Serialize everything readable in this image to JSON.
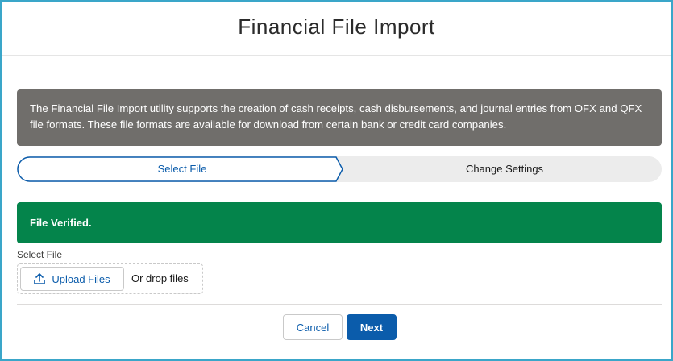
{
  "modal": {
    "title": "Financial File Import"
  },
  "info_banner": {
    "text": "The Financial File Import utility supports the creation of cash receipts, cash disbursements, and journal entries from OFX and QFX file formats. These file formats are available for download from certain bank or credit card companies."
  },
  "path": {
    "steps": [
      {
        "label": "Select File",
        "state": "current"
      },
      {
        "label": "Change Settings",
        "state": "incomplete"
      }
    ]
  },
  "success_banner": {
    "text": "File Verified."
  },
  "file_upload": {
    "label": "Select File",
    "button_label": "Upload Files",
    "button_icon": "upload-icon",
    "drop_text": "Or drop files"
  },
  "footer": {
    "cancel_label": "Cancel",
    "next_label": "Next"
  },
  "colors": {
    "frame_border": "#3aa6c9",
    "info_banner_bg": "#706e6b",
    "success_banner_bg": "#04844b",
    "brand_blue": "#0b5cab",
    "path_incomplete_bg": "#ececec"
  }
}
